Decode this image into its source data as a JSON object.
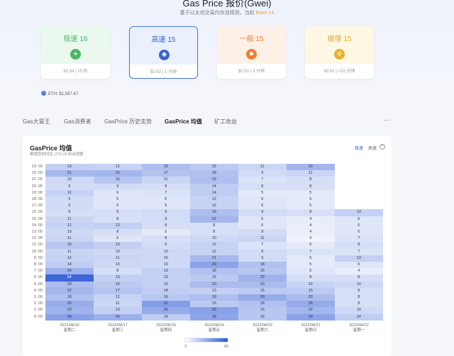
{
  "header": {
    "title": "Gas Price 报价(Gwei)",
    "subtitle": "基于以太坊交易内存池预测，当前",
    "subtitle_highlight": "Base:14"
  },
  "cards": [
    {
      "name": "极速 16",
      "price": "$0.54",
      "time": "15 秒",
      "color": "#4eb569",
      "bg": "#eaf8ee",
      "icon": "rocket-icon"
    },
    {
      "name": "高速 15",
      "price": "$0.52",
      "time": "1 分钟",
      "color": "#3a63c8",
      "bg": "#eaf0fc",
      "icon": "car-icon"
    },
    {
      "name": "一般 15",
      "price": "$0.52",
      "time": "3 分钟",
      "color": "#ee7d33",
      "bg": "#fdf1e7",
      "icon": "bike-icon"
    },
    {
      "name": "缓慢 15",
      "price": "$0.52",
      "time": ">10 分钟",
      "color": "#e1b234",
      "bg": "#fdf7e4",
      "icon": "walk-icon"
    }
  ],
  "eth_price": "ETH: $1,557.47",
  "tabs": [
    "Gas大胃王",
    "Gas消费者",
    "GasPrice 历史走势",
    "GasPrice 均值",
    "矿工收益"
  ],
  "active_tab": 3,
  "more_label": "···",
  "panel": {
    "title": "GasPrice 均值",
    "subtitle": "根据您的时区 UTC+8 自动调整",
    "toggle_fast": "极速",
    "toggle_high": "高速",
    "help_icon": "question-icon"
  },
  "chart_data": {
    "type": "heatmap",
    "y_categories": [
      "23: 00",
      "22: 00",
      "21: 00",
      "20: 00",
      "19: 00",
      "18: 00",
      "17: 00",
      "16: 00",
      "15: 00",
      "14: 00",
      "13: 00",
      "12: 00",
      "11: 00",
      "10: 00",
      "9: 00",
      "8: 00",
      "7: 00",
      "6: 00",
      "5: 00",
      "4: 00",
      "3: 00",
      "2: 00",
      "1: 00",
      "0: 00"
    ],
    "x_dates": [
      "2022/08/16",
      "2022/08/17",
      "2022/08/18",
      "2022/08/19",
      "2022/08/20",
      "2022/08/21",
      "2022/08/22"
    ],
    "x_weekdays": [
      "星期二",
      "星期三",
      "星期四",
      "星期五",
      "星期六",
      "星期日",
      "星期一"
    ],
    "values": [
      [
        13,
        12,
        19,
        15,
        11,
        22,
        null
      ],
      [
        21,
        22,
        17,
        18,
        9,
        11,
        null
      ],
      [
        10,
        16,
        11,
        19,
        7,
        8,
        null
      ],
      [
        9,
        9,
        8,
        14,
        8,
        8,
        null
      ],
      [
        12,
        6,
        7,
        14,
        5,
        5,
        null
      ],
      [
        9,
        6,
        6,
        12,
        6,
        5,
        null
      ],
      [
        9,
        6,
        6,
        12,
        6,
        5,
        null
      ],
      [
        8,
        8,
        9,
        19,
        9,
        8,
        13
      ],
      [
        11,
        8,
        9,
        22,
        6,
        4,
        6
      ],
      [
        12,
        13,
        8,
        8,
        6,
        4,
        6
      ],
      [
        10,
        8,
        5,
        8,
        9,
        4,
        6
      ],
      [
        11,
        6,
        8,
        10,
        11,
        3,
        7
      ],
      [
        16,
        13,
        9,
        12,
        7,
        5,
        8
      ],
      [
        11,
        10,
        10,
        12,
        9,
        7,
        7
      ],
      [
        12,
        11,
        10,
        21,
        9,
        5,
        13
      ],
      [
        14,
        10,
        10,
        29,
        18,
        5,
        6
      ],
      [
        24,
        8,
        13,
        18,
        16,
        6,
        4
      ],
      [
        54,
        13,
        13,
        15,
        23,
        8,
        8
      ],
      [
        20,
        15,
        13,
        20,
        20,
        12,
        10
      ],
      [
        22,
        17,
        14,
        13,
        15,
        15,
        8
      ],
      [
        18,
        12,
        16,
        19,
        26,
        20,
        8
      ],
      [
        25,
        11,
        31,
        15,
        18,
        26,
        8
      ],
      [
        23,
        13,
        26,
        30,
        16,
        22,
        10
      ],
      [
        30,
        24,
        14,
        28,
        16,
        29,
        14
      ]
    ],
    "color_range": [
      3,
      60
    ],
    "legend_min": "3",
    "legend_max": "60"
  }
}
